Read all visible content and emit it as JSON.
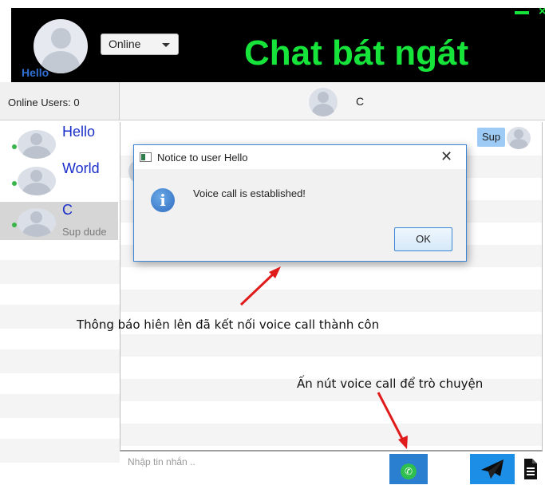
{
  "header": {
    "username": "Hello",
    "status": "Online",
    "app_title": "Chat bát ngát",
    "minimize_glyph": "−",
    "close_glyph": "×"
  },
  "users_panel": {
    "online_label": "Online Users:  0",
    "users": [
      {
        "name": "Hello",
        "status_text": "",
        "online": true,
        "selected": false
      },
      {
        "name": "World",
        "status_text": "",
        "online": true,
        "selected": false
      },
      {
        "name": "C",
        "status_text": "Sup dude",
        "online": true,
        "selected": true
      }
    ]
  },
  "chat": {
    "peer_name": "C",
    "messages": [
      {
        "text": "Sup",
        "from_self": true
      }
    ],
    "input_placeholder": "Nhập tin nhắn .."
  },
  "dialog": {
    "title": "Notice to user Hello",
    "message": "Voice call is established!",
    "ok_label": "OK",
    "icon": "info-icon"
  },
  "annotations": {
    "dialog_note": "Thông báo hiên lên đã kết nối voice call thành côn",
    "call_note": "Ấn nút voice call để trò chuyện"
  },
  "icons": {
    "call": "phone-icon",
    "send": "paper-plane-icon",
    "file": "document-icon"
  },
  "colors": {
    "title_green": "#16e43a",
    "header_bg": "#000000",
    "username_blue": "#2f6fd1",
    "user_name_blue": "#1a2ec9",
    "online_dot": "#39b54a",
    "bubble_blue": "#9ecbf5",
    "send_blue": "#1c8ee6",
    "arrow_red": "#e01b1b"
  }
}
